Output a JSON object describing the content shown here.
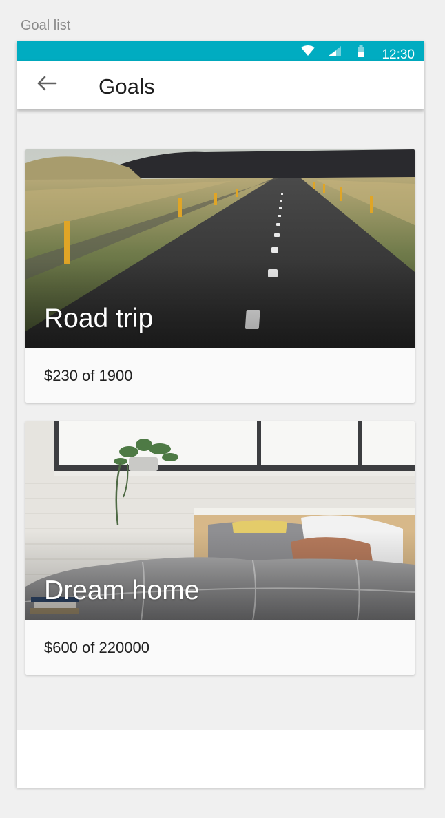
{
  "artboard_label": "Goal list",
  "status_bar": {
    "time": "12:30",
    "background_color": "#00acc1",
    "icons": [
      "wifi-icon",
      "cell-signal-icon",
      "battery-icon"
    ]
  },
  "app_bar": {
    "back_icon": "arrow-left-icon",
    "title": "Goals"
  },
  "goals": [
    {
      "title": "Road trip",
      "amount": "$230 of 1900",
      "image": "road-photo"
    },
    {
      "title": "Dream home",
      "amount": "$600 of 220000",
      "image": "bedroom-photo"
    }
  ]
}
